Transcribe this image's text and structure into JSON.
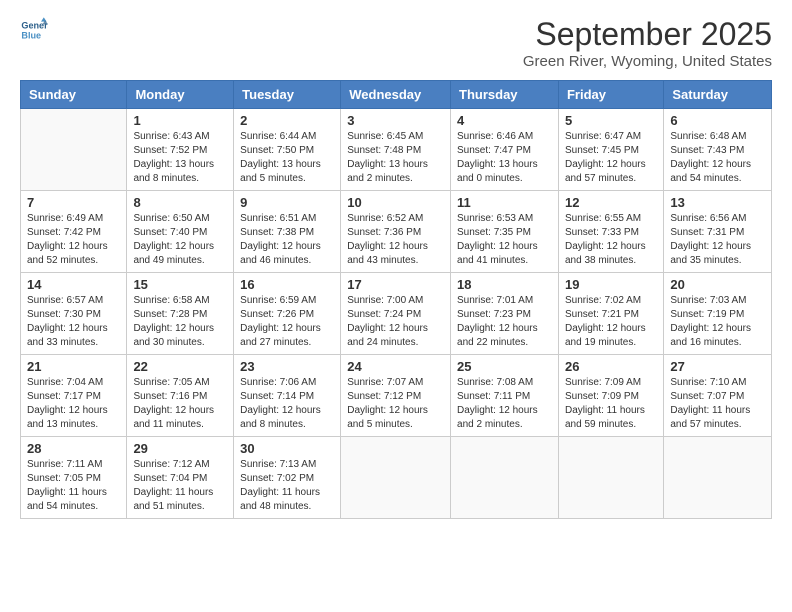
{
  "header": {
    "logo_general": "General",
    "logo_blue": "Blue",
    "month": "September 2025",
    "location": "Green River, Wyoming, United States"
  },
  "weekdays": [
    "Sunday",
    "Monday",
    "Tuesday",
    "Wednesday",
    "Thursday",
    "Friday",
    "Saturday"
  ],
  "weeks": [
    [
      {
        "day": "",
        "sunrise": "",
        "sunset": "",
        "daylight": ""
      },
      {
        "day": "1",
        "sunrise": "Sunrise: 6:43 AM",
        "sunset": "Sunset: 7:52 PM",
        "daylight": "Daylight: 13 hours and 8 minutes."
      },
      {
        "day": "2",
        "sunrise": "Sunrise: 6:44 AM",
        "sunset": "Sunset: 7:50 PM",
        "daylight": "Daylight: 13 hours and 5 minutes."
      },
      {
        "day": "3",
        "sunrise": "Sunrise: 6:45 AM",
        "sunset": "Sunset: 7:48 PM",
        "daylight": "Daylight: 13 hours and 2 minutes."
      },
      {
        "day": "4",
        "sunrise": "Sunrise: 6:46 AM",
        "sunset": "Sunset: 7:47 PM",
        "daylight": "Daylight: 13 hours and 0 minutes."
      },
      {
        "day": "5",
        "sunrise": "Sunrise: 6:47 AM",
        "sunset": "Sunset: 7:45 PM",
        "daylight": "Daylight: 12 hours and 57 minutes."
      },
      {
        "day": "6",
        "sunrise": "Sunrise: 6:48 AM",
        "sunset": "Sunset: 7:43 PM",
        "daylight": "Daylight: 12 hours and 54 minutes."
      }
    ],
    [
      {
        "day": "7",
        "sunrise": "Sunrise: 6:49 AM",
        "sunset": "Sunset: 7:42 PM",
        "daylight": "Daylight: 12 hours and 52 minutes."
      },
      {
        "day": "8",
        "sunrise": "Sunrise: 6:50 AM",
        "sunset": "Sunset: 7:40 PM",
        "daylight": "Daylight: 12 hours and 49 minutes."
      },
      {
        "day": "9",
        "sunrise": "Sunrise: 6:51 AM",
        "sunset": "Sunset: 7:38 PM",
        "daylight": "Daylight: 12 hours and 46 minutes."
      },
      {
        "day": "10",
        "sunrise": "Sunrise: 6:52 AM",
        "sunset": "Sunset: 7:36 PM",
        "daylight": "Daylight: 12 hours and 43 minutes."
      },
      {
        "day": "11",
        "sunrise": "Sunrise: 6:53 AM",
        "sunset": "Sunset: 7:35 PM",
        "daylight": "Daylight: 12 hours and 41 minutes."
      },
      {
        "day": "12",
        "sunrise": "Sunrise: 6:55 AM",
        "sunset": "Sunset: 7:33 PM",
        "daylight": "Daylight: 12 hours and 38 minutes."
      },
      {
        "day": "13",
        "sunrise": "Sunrise: 6:56 AM",
        "sunset": "Sunset: 7:31 PM",
        "daylight": "Daylight: 12 hours and 35 minutes."
      }
    ],
    [
      {
        "day": "14",
        "sunrise": "Sunrise: 6:57 AM",
        "sunset": "Sunset: 7:30 PM",
        "daylight": "Daylight: 12 hours and 33 minutes."
      },
      {
        "day": "15",
        "sunrise": "Sunrise: 6:58 AM",
        "sunset": "Sunset: 7:28 PM",
        "daylight": "Daylight: 12 hours and 30 minutes."
      },
      {
        "day": "16",
        "sunrise": "Sunrise: 6:59 AM",
        "sunset": "Sunset: 7:26 PM",
        "daylight": "Daylight: 12 hours and 27 minutes."
      },
      {
        "day": "17",
        "sunrise": "Sunrise: 7:00 AM",
        "sunset": "Sunset: 7:24 PM",
        "daylight": "Daylight: 12 hours and 24 minutes."
      },
      {
        "day": "18",
        "sunrise": "Sunrise: 7:01 AM",
        "sunset": "Sunset: 7:23 PM",
        "daylight": "Daylight: 12 hours and 22 minutes."
      },
      {
        "day": "19",
        "sunrise": "Sunrise: 7:02 AM",
        "sunset": "Sunset: 7:21 PM",
        "daylight": "Daylight: 12 hours and 19 minutes."
      },
      {
        "day": "20",
        "sunrise": "Sunrise: 7:03 AM",
        "sunset": "Sunset: 7:19 PM",
        "daylight": "Daylight: 12 hours and 16 minutes."
      }
    ],
    [
      {
        "day": "21",
        "sunrise": "Sunrise: 7:04 AM",
        "sunset": "Sunset: 7:17 PM",
        "daylight": "Daylight: 12 hours and 13 minutes."
      },
      {
        "day": "22",
        "sunrise": "Sunrise: 7:05 AM",
        "sunset": "Sunset: 7:16 PM",
        "daylight": "Daylight: 12 hours and 11 minutes."
      },
      {
        "day": "23",
        "sunrise": "Sunrise: 7:06 AM",
        "sunset": "Sunset: 7:14 PM",
        "daylight": "Daylight: 12 hours and 8 minutes."
      },
      {
        "day": "24",
        "sunrise": "Sunrise: 7:07 AM",
        "sunset": "Sunset: 7:12 PM",
        "daylight": "Daylight: 12 hours and 5 minutes."
      },
      {
        "day": "25",
        "sunrise": "Sunrise: 7:08 AM",
        "sunset": "Sunset: 7:11 PM",
        "daylight": "Daylight: 12 hours and 2 minutes."
      },
      {
        "day": "26",
        "sunrise": "Sunrise: 7:09 AM",
        "sunset": "Sunset: 7:09 PM",
        "daylight": "Daylight: 11 hours and 59 minutes."
      },
      {
        "day": "27",
        "sunrise": "Sunrise: 7:10 AM",
        "sunset": "Sunset: 7:07 PM",
        "daylight": "Daylight: 11 hours and 57 minutes."
      }
    ],
    [
      {
        "day": "28",
        "sunrise": "Sunrise: 7:11 AM",
        "sunset": "Sunset: 7:05 PM",
        "daylight": "Daylight: 11 hours and 54 minutes."
      },
      {
        "day": "29",
        "sunrise": "Sunrise: 7:12 AM",
        "sunset": "Sunset: 7:04 PM",
        "daylight": "Daylight: 11 hours and 51 minutes."
      },
      {
        "day": "30",
        "sunrise": "Sunrise: 7:13 AM",
        "sunset": "Sunset: 7:02 PM",
        "daylight": "Daylight: 11 hours and 48 minutes."
      },
      {
        "day": "",
        "sunrise": "",
        "sunset": "",
        "daylight": ""
      },
      {
        "day": "",
        "sunrise": "",
        "sunset": "",
        "daylight": ""
      },
      {
        "day": "",
        "sunrise": "",
        "sunset": "",
        "daylight": ""
      },
      {
        "day": "",
        "sunrise": "",
        "sunset": "",
        "daylight": ""
      }
    ]
  ]
}
